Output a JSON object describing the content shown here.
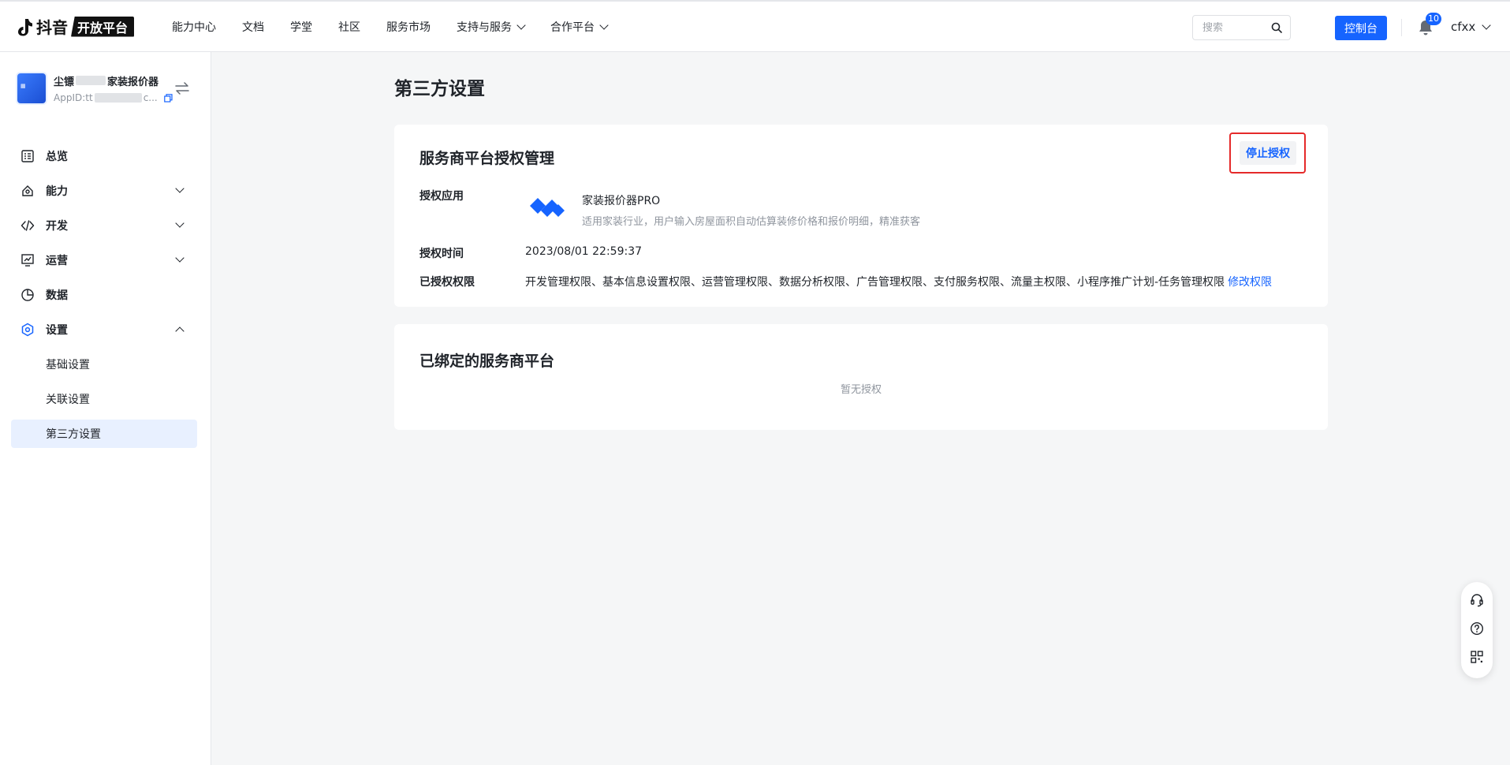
{
  "brand": {
    "name": "抖音",
    "badge": "开放平台"
  },
  "nav": [
    {
      "label": "能力中心"
    },
    {
      "label": "文档"
    },
    {
      "label": "学堂"
    },
    {
      "label": "社区"
    },
    {
      "label": "服务市场"
    },
    {
      "label": "支持与服务"
    },
    {
      "label": "合作平台"
    }
  ],
  "search": {
    "placeholder": "搜索"
  },
  "console_label": "控制台",
  "notifications": {
    "count": "10"
  },
  "user": {
    "name": "cfxx"
  },
  "app": {
    "name_prefix": "尘镖",
    "name_suffix": "家装报价器",
    "id_prefix": "AppID:tt",
    "id_suffix": "c..."
  },
  "menu": [
    {
      "label": "总览",
      "icon": "overview-icon"
    },
    {
      "label": "能力",
      "icon": "capability-icon"
    },
    {
      "label": "开发",
      "icon": "code-icon"
    },
    {
      "label": "运营",
      "icon": "operation-icon"
    },
    {
      "label": "数据",
      "icon": "pie-chart-icon"
    },
    {
      "label": "设置",
      "icon": "settings-icon"
    }
  ],
  "settings_submenu": [
    {
      "label": "基础设置"
    },
    {
      "label": "关联设置"
    },
    {
      "label": "第三方设置"
    }
  ],
  "page_title": "第三方设置",
  "auth_card": {
    "title": "服务商平台授权管理",
    "stop_button": "停止授权",
    "app_label": "授权应用",
    "app_name": "家装报价器PRO",
    "app_desc": "适用家装行业，用户输入房屋面积自动估算装修价格和报价明细，精准获客",
    "time_label": "授权时间",
    "time_value": "2023/08/01 22:59:37",
    "perm_label": "已授权权限",
    "perm_value": "开发管理权限、基本信息设置权限、运营管理权限、数据分析权限、广告管理权限、支付服务权限、流量主权限、小程序推广计划-任务管理权限",
    "modify_link": "修改权限"
  },
  "bound_card": {
    "title": "已绑定的服务商平台",
    "empty_text": "暂无授权"
  },
  "colors": {
    "primary": "#1664ff",
    "highlight_border": "#e52a2a",
    "active_bg": "#e8f0ff"
  }
}
